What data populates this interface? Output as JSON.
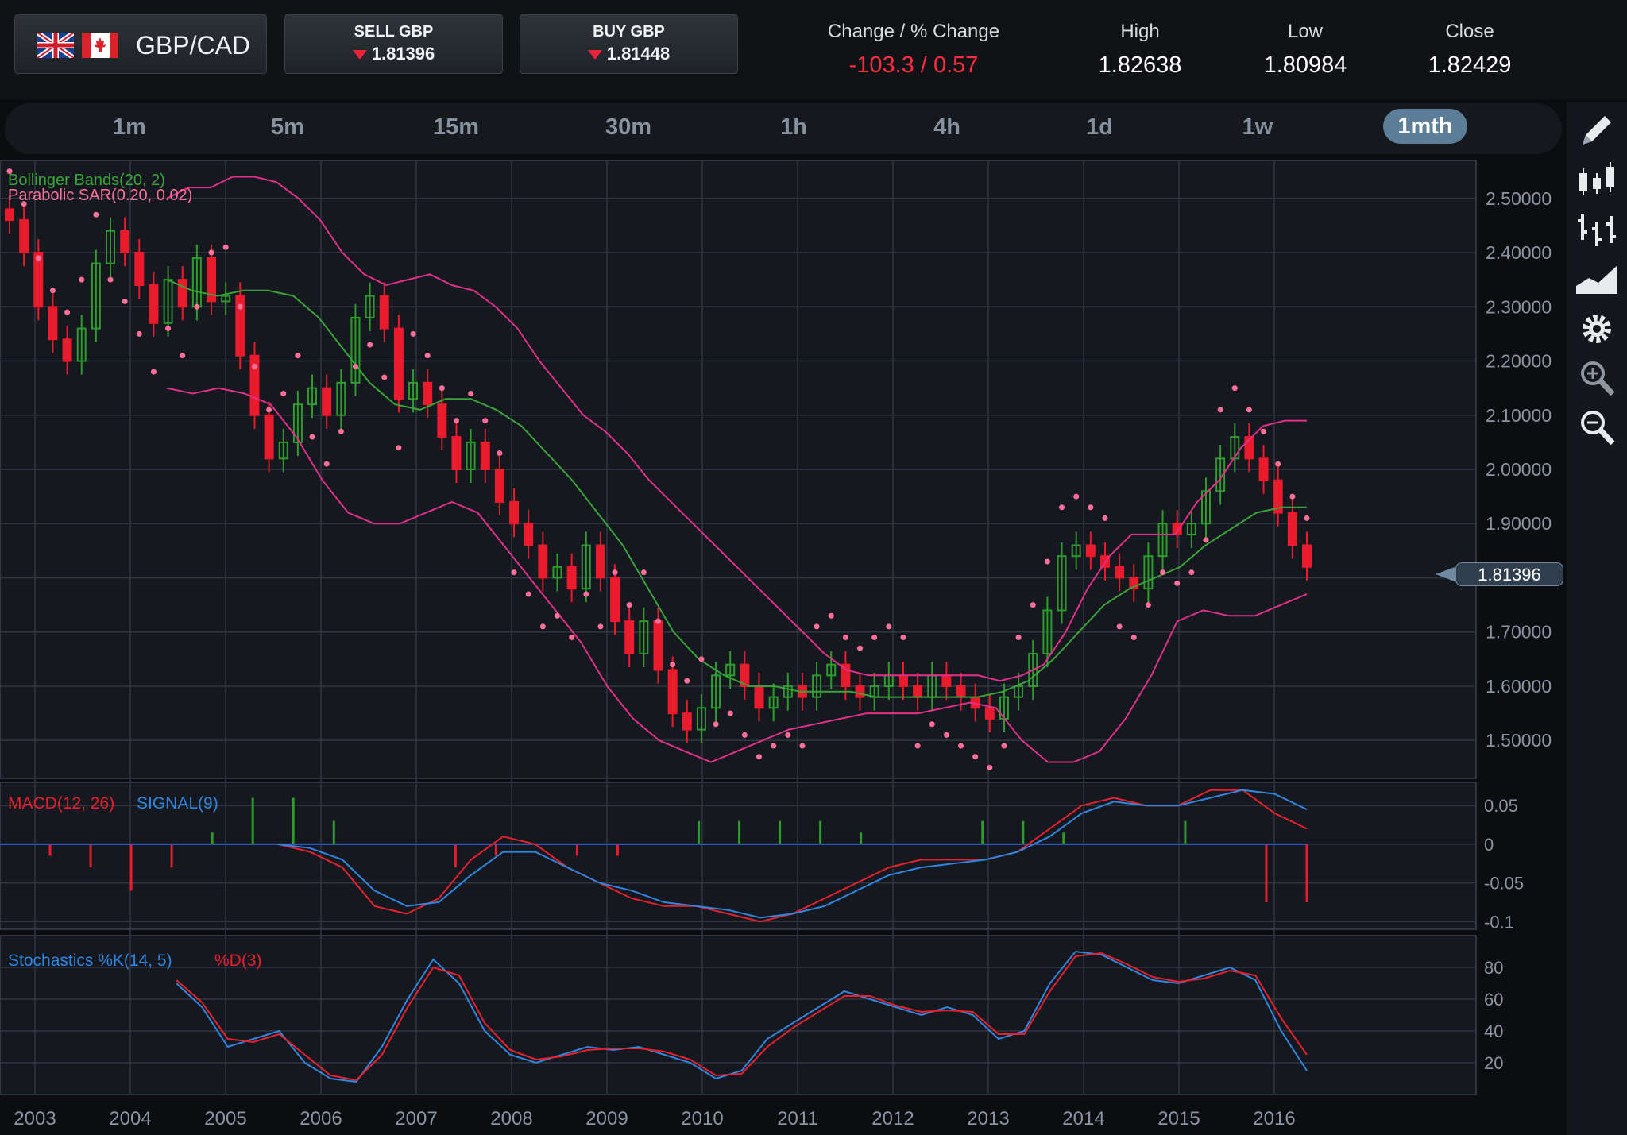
{
  "header": {
    "pair_label": "GBP/CAD",
    "sell": {
      "label": "SELL GBP",
      "price": "1.81396"
    },
    "buy": {
      "label": "BUY GBP",
      "price": "1.81448"
    },
    "stats": [
      {
        "label": "Change / % Change",
        "value": "-103.3 / 0.57",
        "color": "#ff2d3f"
      },
      {
        "label": "High",
        "value": "1.82638",
        "color": "#ffffff"
      },
      {
        "label": "Low",
        "value": "1.80984",
        "color": "#ffffff"
      },
      {
        "label": "Close",
        "value": "1.82429",
        "color": "#ffffff"
      }
    ]
  },
  "timeframes": [
    "1m",
    "5m",
    "15m",
    "30m",
    "1h",
    "4h",
    "1d",
    "1w",
    "1mth"
  ],
  "active_timeframe": "1mth",
  "sidebar_tools": [
    "pencil-icon",
    "candlestick-icon",
    "bars-icon",
    "area-chart-icon",
    "gear-icon",
    "zoom-in-icon",
    "zoom-out-icon"
  ],
  "current_price_tag": "1.81396",
  "chart_data": {
    "type": "candlestick",
    "x_axis": [
      "2003",
      "2004",
      "2005",
      "2006",
      "2007",
      "2008",
      "2009",
      "2010",
      "2011",
      "2012",
      "2013",
      "2014",
      "2015",
      "2016"
    ],
    "main": {
      "indicators": [
        "Bollinger Bands(20, 2)",
        "Parabolic SAR(0.20, 0.02)"
      ],
      "ylim": [
        1.43,
        2.57
      ],
      "y_ticks": [
        "2.50000",
        "2.40000",
        "2.30000",
        "2.20000",
        "2.10000",
        "2.00000",
        "1.90000",
        "1.80000",
        "1.70000",
        "1.60000",
        "1.50000"
      ],
      "close": [
        2.46,
        2.4,
        2.3,
        2.24,
        2.2,
        2.26,
        2.38,
        2.44,
        2.4,
        2.34,
        2.27,
        2.35,
        2.3,
        2.39,
        2.31,
        2.32,
        2.21,
        2.1,
        2.02,
        2.05,
        2.12,
        2.15,
        2.1,
        2.16,
        2.28,
        2.32,
        2.26,
        2.13,
        2.16,
        2.12,
        2.06,
        2.0,
        2.05,
        2.0,
        1.94,
        1.9,
        1.86,
        1.8,
        1.82,
        1.78,
        1.86,
        1.8,
        1.72,
        1.66,
        1.72,
        1.63,
        1.55,
        1.52,
        1.56,
        1.62,
        1.64,
        1.6,
        1.56,
        1.58,
        1.6,
        1.58,
        1.62,
        1.64,
        1.6,
        1.58,
        1.6,
        1.62,
        1.6,
        1.58,
        1.62,
        1.6,
        1.58,
        1.56,
        1.54,
        1.58,
        1.6,
        1.66,
        1.74,
        1.84,
        1.86,
        1.84,
        1.82,
        1.8,
        1.78,
        1.84,
        1.9,
        1.88,
        1.9,
        1.96,
        2.02,
        2.06,
        2.02,
        1.98,
        1.92,
        1.86,
        1.82
      ],
      "bb_upper": [
        2.5,
        2.52,
        2.52,
        2.54,
        2.54,
        2.53,
        2.5,
        2.46,
        2.4,
        2.36,
        2.34,
        2.35,
        2.36,
        2.34,
        2.33,
        2.3,
        2.26,
        2.2,
        2.15,
        2.1,
        2.07,
        2.03,
        1.98,
        1.94,
        1.9,
        1.86,
        1.82,
        1.78,
        1.74,
        1.7,
        1.66,
        1.63,
        1.62,
        1.62,
        1.62,
        1.62,
        1.62,
        1.62,
        1.61,
        1.62,
        1.64,
        1.7,
        1.78,
        1.84,
        1.88,
        1.88,
        1.88,
        1.94,
        1.98,
        2.04,
        2.08,
        2.09,
        2.09
      ],
      "bb_middle": [
        2.35,
        2.33,
        2.32,
        2.33,
        2.33,
        2.32,
        2.28,
        2.22,
        2.16,
        2.12,
        2.11,
        2.13,
        2.13,
        2.11,
        2.08,
        2.03,
        1.98,
        1.92,
        1.86,
        1.78,
        1.7,
        1.65,
        1.62,
        1.6,
        1.6,
        1.59,
        1.59,
        1.59,
        1.58,
        1.58,
        1.58,
        1.58,
        1.58,
        1.59,
        1.61,
        1.65,
        1.7,
        1.75,
        1.78,
        1.8,
        1.82,
        1.86,
        1.89,
        1.92,
        1.93,
        1.93
      ],
      "bb_lower": [
        2.15,
        2.14,
        2.15,
        2.14,
        2.12,
        2.06,
        1.98,
        1.92,
        1.9,
        1.9,
        1.92,
        1.94,
        1.92,
        1.86,
        1.8,
        1.74,
        1.68,
        1.6,
        1.54,
        1.5,
        1.48,
        1.46,
        1.48,
        1.5,
        1.52,
        1.53,
        1.54,
        1.55,
        1.55,
        1.55,
        1.56,
        1.57,
        1.56,
        1.5,
        1.46,
        1.46,
        1.48,
        1.54,
        1.62,
        1.72,
        1.74,
        1.73,
        1.73,
        1.75,
        1.77
      ]
    },
    "macd": {
      "label": "MACD(12, 26)",
      "signal_label": "SIGNAL(9)",
      "y_ticks": [
        "0.05",
        "0",
        "-0.05",
        "-0.1"
      ],
      "ylim": [
        -0.11,
        0.08
      ],
      "macd": [
        0,
        -0.01,
        -0.03,
        -0.08,
        -0.09,
        -0.07,
        -0.02,
        0.01,
        0.0,
        -0.03,
        -0.05,
        -0.07,
        -0.08,
        -0.08,
        -0.09,
        -0.1,
        -0.09,
        -0.07,
        -0.05,
        -0.03,
        -0.02,
        -0.02,
        -0.02,
        -0.01,
        0.02,
        0.05,
        0.06,
        0.05,
        0.05,
        0.07,
        0.07,
        0.04,
        0.02
      ],
      "signal": [
        0,
        -0.005,
        -0.02,
        -0.06,
        -0.08,
        -0.075,
        -0.04,
        -0.01,
        -0.01,
        -0.03,
        -0.05,
        -0.06,
        -0.075,
        -0.08,
        -0.085,
        -0.095,
        -0.09,
        -0.08,
        -0.06,
        -0.04,
        -0.03,
        -0.025,
        -0.02,
        -0.01,
        0.01,
        0.04,
        0.055,
        0.05,
        0.05,
        0.06,
        0.07,
        0.065,
        0.045
      ]
    },
    "stochastics": {
      "label": "Stochastics %K(14, 5)",
      "d_label": "%D(3)",
      "y_ticks": [
        "80",
        "60",
        "40",
        "20"
      ],
      "ylim": [
        0,
        100
      ],
      "k": [
        70,
        55,
        30,
        35,
        40,
        20,
        10,
        8,
        30,
        60,
        85,
        70,
        40,
        25,
        20,
        25,
        30,
        28,
        30,
        25,
        20,
        10,
        15,
        35,
        45,
        55,
        65,
        60,
        55,
        50,
        55,
        50,
        35,
        40,
        70,
        90,
        88,
        80,
        72,
        70,
        75,
        80,
        72,
        40,
        15
      ],
      "d": [
        72,
        58,
        35,
        33,
        38,
        25,
        12,
        9,
        25,
        55,
        80,
        75,
        45,
        28,
        22,
        24,
        28,
        29,
        29,
        27,
        22,
        12,
        13,
        30,
        42,
        52,
        62,
        62,
        56,
        52,
        53,
        52,
        38,
        38,
        65,
        87,
        89,
        82,
        74,
        71,
        73,
        78,
        75,
        48,
        25
      ]
    }
  }
}
